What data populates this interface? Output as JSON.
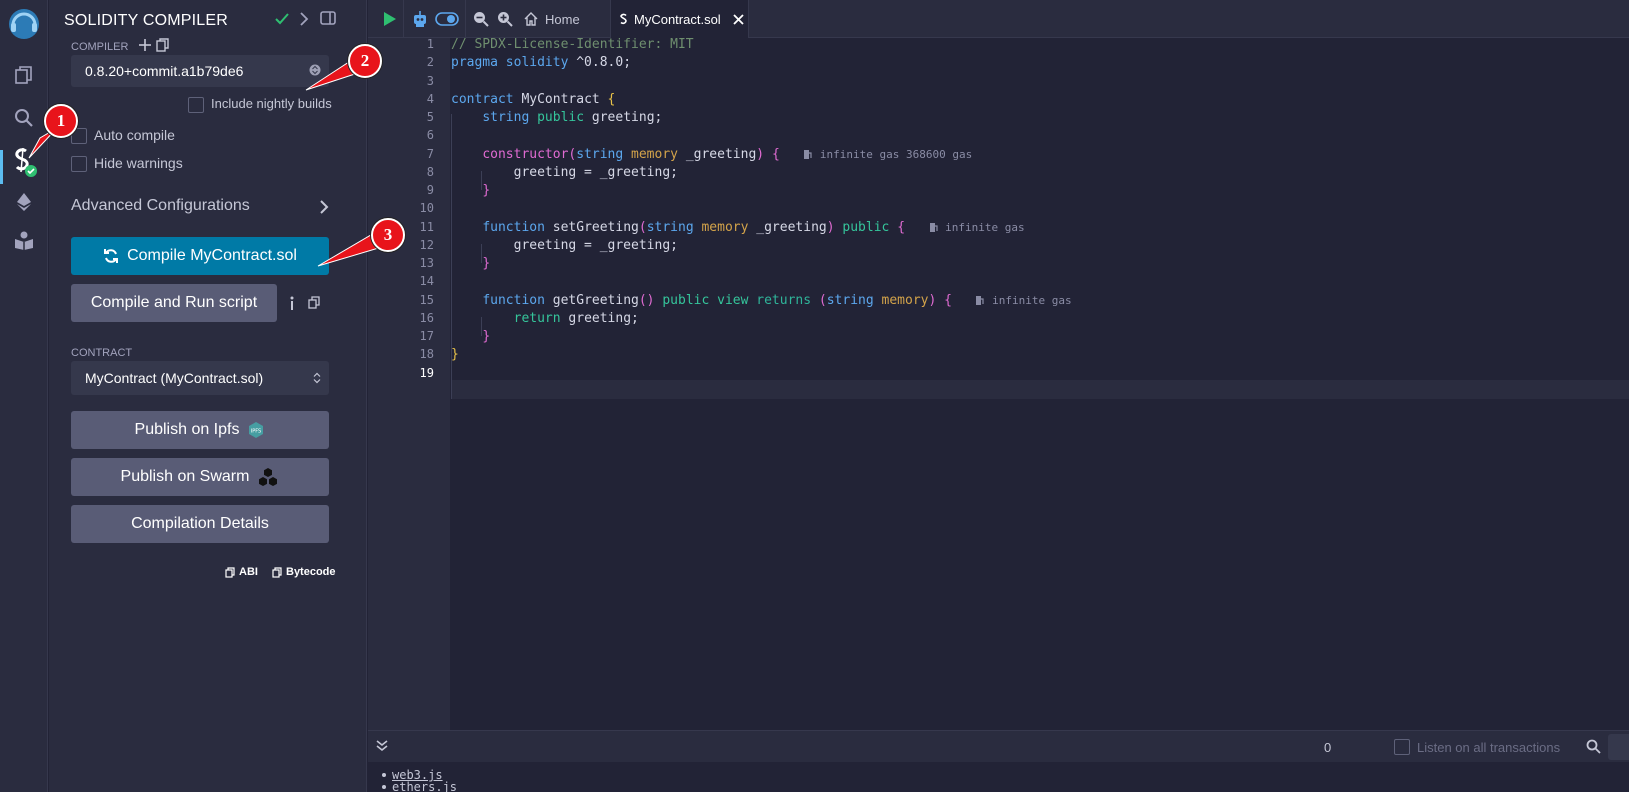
{
  "panel": {
    "title": "SOLIDITY COMPILER",
    "compiler_label": "COMPILER",
    "compiler_version": "0.8.20+commit.a1b79de6",
    "include_nightly": "Include nightly builds",
    "auto_compile": "Auto compile",
    "hide_warnings": "Hide warnings",
    "advanced": "Advanced Configurations",
    "compile_button": "Compile MyContract.sol",
    "compile_run_button": "Compile and Run script",
    "contract_label": "CONTRACT",
    "contract_value": "MyContract (MyContract.sol)",
    "publish_ipfs": "Publish on Ipfs",
    "publish_swarm": "Publish on Swarm",
    "compilation_details": "Compilation Details",
    "abi": "ABI",
    "bytecode": "Bytecode"
  },
  "tabs": {
    "home": "Home",
    "file": "MyContract.sol"
  },
  "editor": {
    "line_numbers": [
      "1",
      "2",
      "3",
      "4",
      "5",
      "6",
      "7",
      "8",
      "9",
      "10",
      "11",
      "12",
      "13",
      "14",
      "15",
      "16",
      "17",
      "18",
      "19"
    ],
    "gas1": "infinite gas 368600 gas",
    "gas2": "infinite gas",
    "gas3": "infinite gas"
  },
  "terminal": {
    "count": "0",
    "listen": "Listen on all transactions",
    "link1": "web3.js",
    "link2": "ethers.js"
  },
  "annotations": [
    "1",
    "2",
    "3"
  ],
  "colors": {
    "accent": "#007aa6",
    "callout": "#e8141b",
    "success": "#2fbf71"
  }
}
